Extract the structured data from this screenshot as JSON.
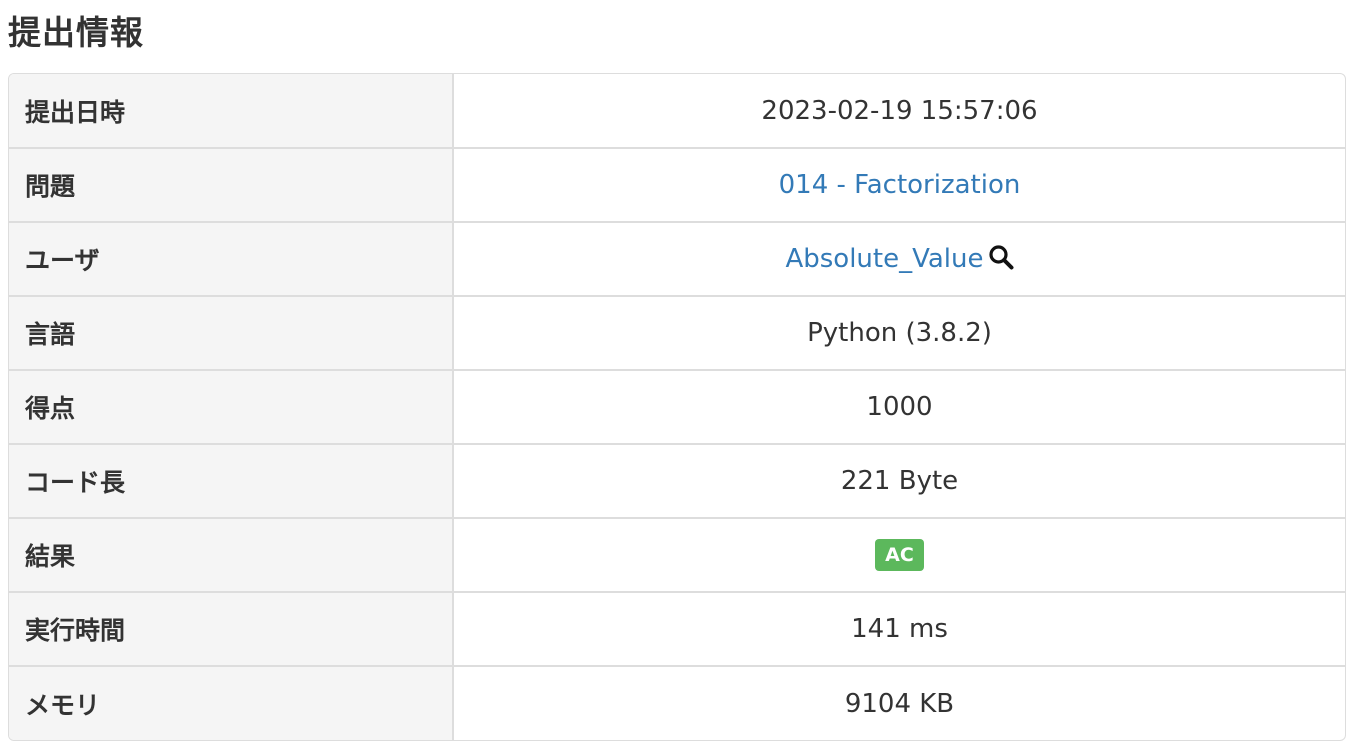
{
  "page": {
    "heading": "提出情報"
  },
  "submission": {
    "rows": [
      {
        "label": "提出日時",
        "value": "2023-02-19 15:57:06"
      },
      {
        "label": "問題",
        "value": "014 - Factorization"
      },
      {
        "label": "ユーザ",
        "value": "Absolute_Value"
      },
      {
        "label": "言語",
        "value": "Python (3.8.2)"
      },
      {
        "label": "得点",
        "value": "1000"
      },
      {
        "label": "コード長",
        "value": "221 Byte"
      },
      {
        "label": "結果",
        "value": "AC"
      },
      {
        "label": "実行時間",
        "value": "141 ms"
      },
      {
        "label": "メモリ",
        "value": "9104 KB"
      }
    ]
  },
  "icons": {
    "user_search": "search-icon"
  },
  "colors": {
    "link": "#337ab7",
    "status_ac": "#5cb85c",
    "header_bg": "#f5f5f5",
    "border": "#dddddd",
    "text": "#333333"
  }
}
